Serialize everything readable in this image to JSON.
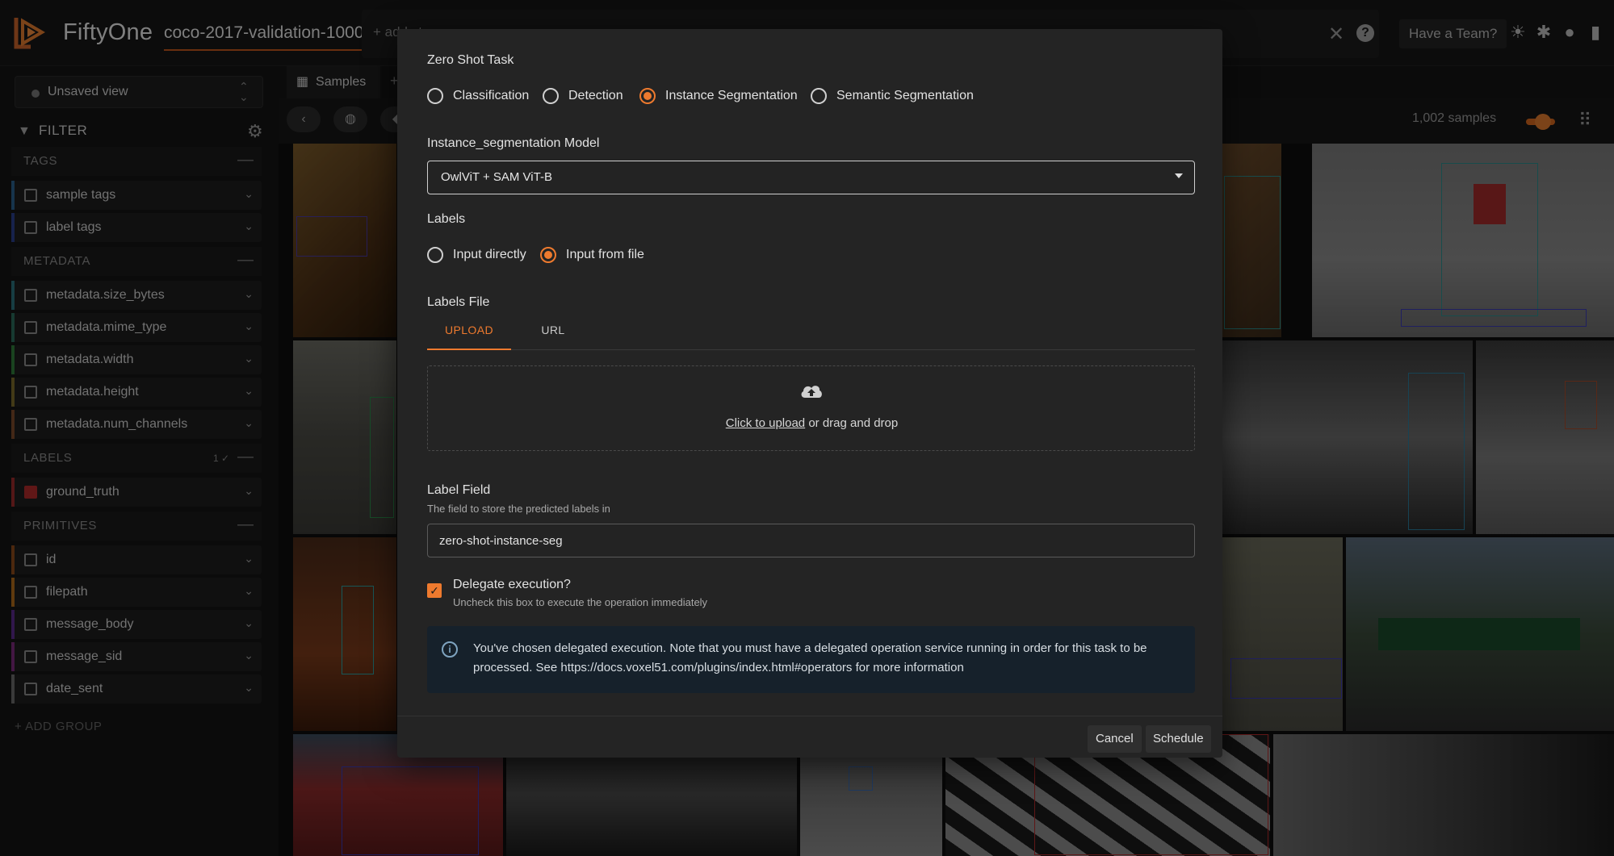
{
  "app": {
    "brand": "FiftyOne",
    "dataset": "coco-2017-validation-1000",
    "add_stage": "+ add stage",
    "team_button": "Have a Team?",
    "accent": "#ee7a2e"
  },
  "sidebar": {
    "view": "Unsaved view",
    "filter_label": "FILTER",
    "groups": [
      {
        "label": "TAGS",
        "fields": [
          "sample tags",
          "label tags"
        ]
      },
      {
        "label": "METADATA",
        "fields": [
          "metadata.size_bytes",
          "metadata.mime_type",
          "metadata.width",
          "metadata.height",
          "metadata.num_channels"
        ]
      },
      {
        "label": "LABELS",
        "count": "1 ✓",
        "fields": [
          "ground_truth"
        ]
      },
      {
        "label": "PRIMITIVES",
        "fields": [
          "id",
          "filepath",
          "message_body",
          "message_sid",
          "date_sent"
        ]
      }
    ],
    "add_group": "+ ADD GROUP"
  },
  "grid": {
    "tab": "Samples",
    "sample_count": "1,002 samples"
  },
  "modal": {
    "task_label": "Zero Shot Task",
    "task_options": [
      "Classification",
      "Detection",
      "Instance Segmentation",
      "Semantic Segmentation"
    ],
    "selected_task": "Instance Segmentation",
    "model_label": "Instance_segmentation Model",
    "model_value": "OwlViT + SAM ViT-B",
    "labels_label": "Labels",
    "labels_options": [
      "Input directly",
      "Input from file"
    ],
    "selected_labels_option": "Input from file",
    "labels_file_label": "Labels File",
    "file_tabs": [
      "UPLOAD",
      "URL"
    ],
    "upload_link": "Click to upload",
    "upload_rest": " or drag and drop",
    "label_field_label": "Label Field",
    "label_field_desc": "The field to store the predicted labels in",
    "label_field_value": "zero-shot-instance-seg",
    "delegate_label": "Delegate execution?",
    "delegate_desc": "Uncheck this box to execute the operation immediately",
    "delegate_checked": true,
    "info_text": "You've chosen delegated execution. Note that you must have a delegated operation service running in order for this task to be processed. See https://docs.voxel51.com/plugins/index.html#operators for more information",
    "cancel": "Cancel",
    "schedule": "Schedule"
  }
}
